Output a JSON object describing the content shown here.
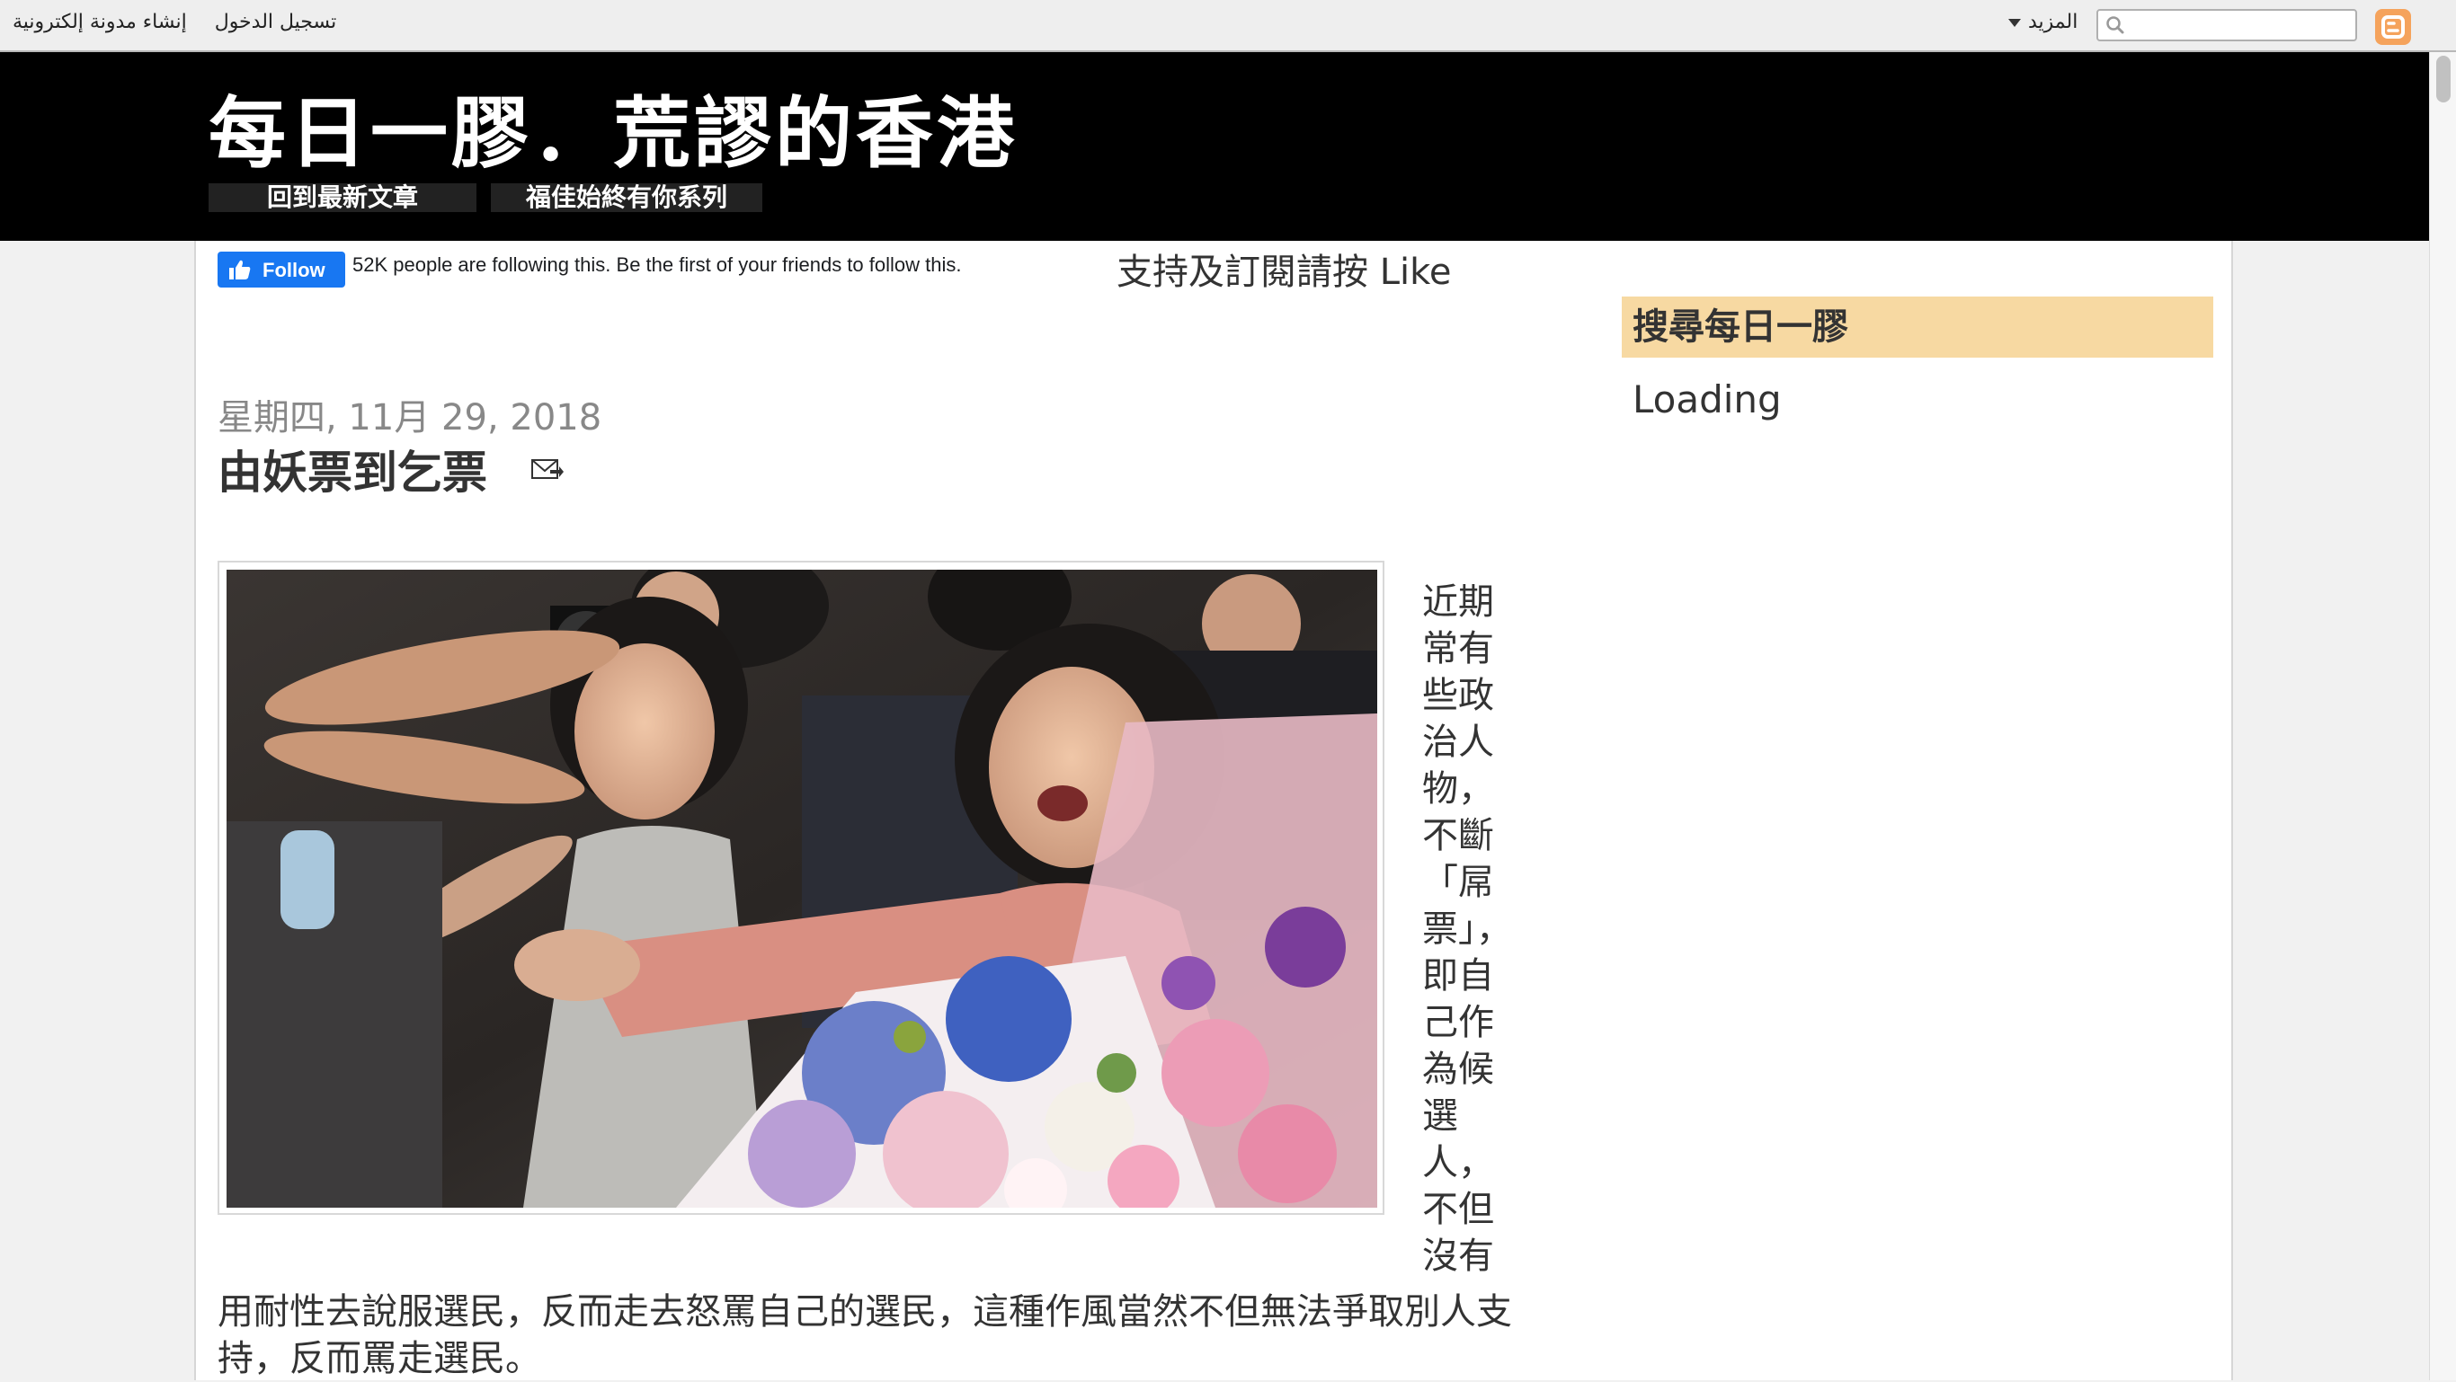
{
  "navbar": {
    "login_label": "تسجيل الدخول",
    "create_blog_label": "إنشاء مدونة إلكترونية",
    "more_label": "المزيد",
    "search_placeholder": "",
    "logo_icon": "blogger-logo-icon",
    "accent": "#f5a35c"
  },
  "header": {
    "title": "每日一膠．荒謬的香港",
    "tabs": [
      {
        "label": "回到最新文章"
      },
      {
        "label": "福佳始終有你系列"
      }
    ]
  },
  "facebook": {
    "follow_label": "Follow",
    "follow_text": "52K people are following this. Be the first of your friends to follow this.",
    "brand_color": "#1877f2"
  },
  "support_text": "支持及訂閱請按 Like",
  "post": {
    "date": "星期四, 11月 29, 2018",
    "title": "由妖票到乞票",
    "email_icon": "email-post-icon",
    "image_icon": "post-photo",
    "side_text": "近期常有些政治人物，不斷「屌票」，即自己作為候選人，不但沒有",
    "body_text": "用耐性去說服選民，反而走去怒罵自己的選民，這種作風當然不但無法爭取別人支持，反而罵走選民。"
  },
  "sidebar": {
    "title": "搜尋每日一膠",
    "loading": "Loading",
    "title_bg": "#f7d9a2"
  }
}
